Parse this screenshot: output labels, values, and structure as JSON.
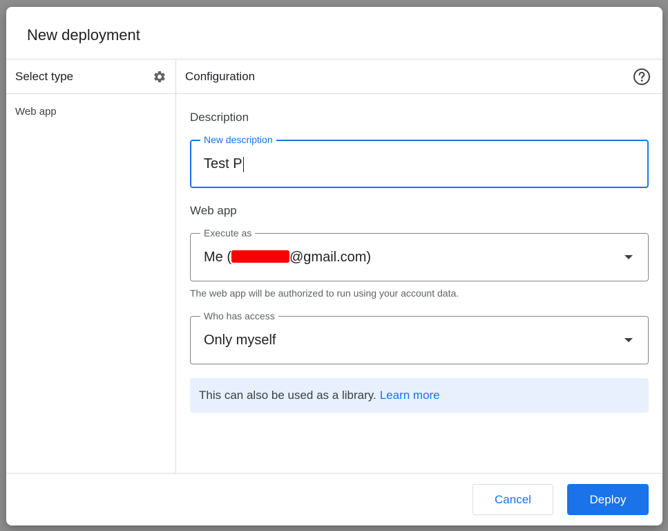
{
  "dialog": {
    "title": "New deployment"
  },
  "left_pane": {
    "header": "Select type",
    "header_icon": "gear-icon",
    "items": [
      {
        "label": "Web app"
      }
    ]
  },
  "right_pane": {
    "header": "Configuration",
    "header_icon": "help-icon",
    "description_section": "Description",
    "description_field": {
      "label": "New description",
      "value": "Test P"
    },
    "webapp_section": "Web app",
    "execute_as": {
      "label": "Execute as",
      "value_prefix": "Me (",
      "value_suffix": "@gmail.com)"
    },
    "execute_hint": "The web app will be authorized to run using your account data.",
    "who_has_access": {
      "label": "Who has access",
      "value": "Only myself"
    },
    "info": {
      "text": "This can also be used as a library.",
      "link": "Learn more"
    }
  },
  "footer": {
    "cancel_label": "Cancel",
    "deploy_label": "Deploy"
  },
  "colors": {
    "accent": "#1a73e8",
    "info_bg": "#e8f0fe",
    "redaction": "#ff0000"
  }
}
